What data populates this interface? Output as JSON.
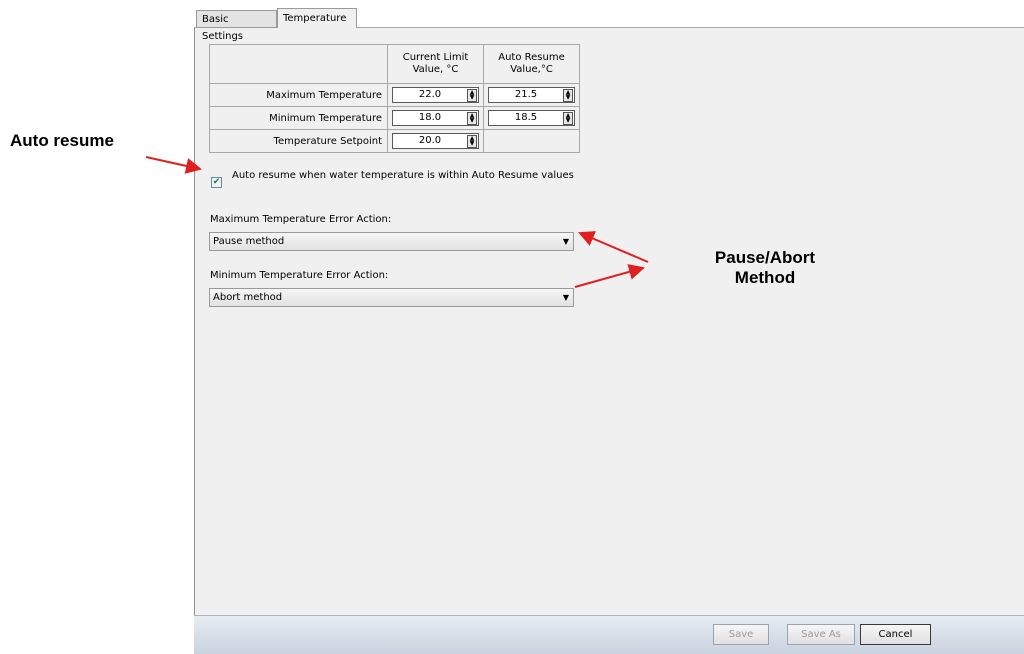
{
  "tabs": [
    {
      "label": "Basic Settings",
      "active": false
    },
    {
      "label": "Temperature",
      "active": true
    }
  ],
  "temperature_table": {
    "headers": [
      "",
      "Current Limit Value, °C",
      "Auto Resume Value,°C"
    ],
    "rows": [
      {
        "label": "Maximum Temperature",
        "current": "22.0",
        "auto_resume": "21.5"
      },
      {
        "label": "Minimum Temperature",
        "current": "18.0",
        "auto_resume": "18.5"
      },
      {
        "label": "Temperature Setpoint",
        "current": "20.0",
        "auto_resume": null
      }
    ]
  },
  "auto_resume_checkbox": {
    "checked": true,
    "label": "Auto resume when water temperature is within Auto Resume values"
  },
  "max_error_action": {
    "label": "Maximum Temperature Error Action:",
    "value": "Pause method"
  },
  "min_error_action": {
    "label": "Minimum Temperature Error Action:",
    "value": "Abort method"
  },
  "buttons": {
    "save": "Save",
    "save_as": "Save As",
    "cancel": "Cancel"
  },
  "annotations": {
    "auto_resume": "Auto resume",
    "pause_abort_line1": "Pause/Abort",
    "pause_abort_line2": "Method"
  },
  "colors": {
    "annotation_arrow": "#e02020",
    "panel_bg": "#f0f0f0"
  }
}
